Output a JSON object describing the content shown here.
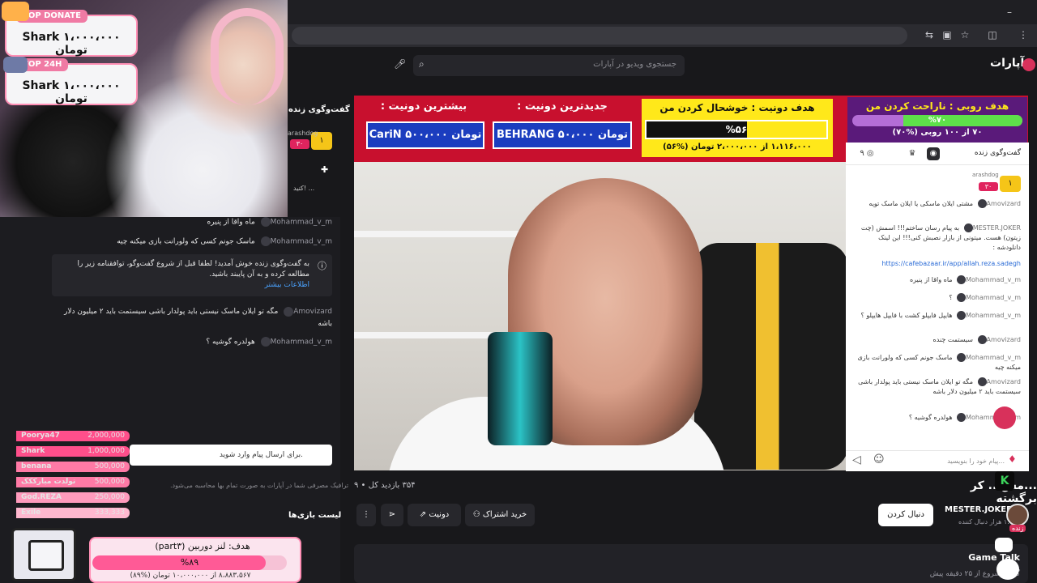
{
  "site": {
    "logo": "آپارات",
    "search_placeholder": "جستجوی ویدیو در آپارات"
  },
  "overlay": {
    "top_donate": {
      "tag": "TOP DONATE",
      "amount": "Shark ۱،۰۰۰،۰۰۰ تومان"
    },
    "top_24h": {
      "tag": "TOP 24H",
      "amount": "Shark ۱،۰۰۰،۰۰۰ تومان"
    }
  },
  "left_chat": {
    "title": "گفت‌وگوی زنده",
    "badge_user": "arashdog",
    "badge_level": "۳۰",
    "badge_num": "۱",
    "pinned": "کنید! ...",
    "messages": [
      {
        "user": "Mohammad_v_m",
        "text": "ماه واقا از پنیره"
      },
      {
        "user": "Mohammad_v_m",
        "text": "ماسک جونم کسی که ولورانت بازی میکنه چیه"
      },
      {
        "user": "Amovizard",
        "text": "مگه تو ایلان ماسک نیستی باید پولدار باشی سیستمت باید ۲ میلیون دلار باشه"
      },
      {
        "user": "Mohammad_v_m",
        "text": "هولدره گوشیه ؟"
      }
    ],
    "welcome": "به گفت‌وگوی زنده خوش آمدید! لطفا قبل از شروع گفت‌وگو، توافقنامه زیر را مطالعه کرده و به آن پایبند باشید.",
    "welcome_link": "اطلاعات بیشتر",
    "input_placeholder": "برای ارسال پیام وارد شوید.",
    "traffic_note": "ترافیک مصرفی شما در آپارات به صورت تمام بها محاسبه می‌شود.",
    "games_title": "لیست بازی‌ها"
  },
  "leaderboard": [
    {
      "name": "Poorya47",
      "value": "2,000,000",
      "color": "#ff4f8b"
    },
    {
      "name": "Shark",
      "value": "1,000,000",
      "color": "#ff4f8b"
    },
    {
      "name": "benana",
      "value": "500,000",
      "color": "#ff7aa6"
    },
    {
      "name": "تولدت مبارککک",
      "value": "500,000",
      "color": "#ff7aa6"
    },
    {
      "name": "God.REZA",
      "value": "250,000",
      "color": "#ff9bbd"
    },
    {
      "name": "Exile",
      "value": "333,333",
      "color": "#ffb8cf"
    }
  ],
  "bottom_goal": {
    "title": "هدف: لنز دوربین (part۳)",
    "percent": "%۸۹",
    "progress": 0.89,
    "sub": "۸،۸۸۳،۵۶۷ از ۱۰،۰۰۰،۰۰۰ تومان (%۸۹)"
  },
  "banner": {
    "top_title": "بیشترین دونیت :",
    "top_value": "CariN ۵۰۰،۰۰۰ تومان",
    "latest_title": "جدیدترین دونیت :",
    "latest_value": "BEHRANG ۵۰،۰۰۰ تومان",
    "goal_title": "هدف دونیت : خوشحال کردن من",
    "goal_pct": "%۵۶",
    "goal_progress": 0.56,
    "goal_sub": "۱،۱۱۶،۰۰۰ از ۲،۰۰۰،۰۰۰ تومان (%۵۶)",
    "ruby_title": "هدف روبی : ناراحت کردن من",
    "ruby_pct": "%۷۰",
    "ruby_progress": 0.7,
    "ruby_sub": "۷۰ از ۱۰۰ روبی (%۷۰)"
  },
  "right_chat": {
    "title": "گفت‌وگوی زنده",
    "viewers": "۹",
    "badge_user": "arashdog",
    "badge_level": "۳۰",
    "badge_num": "۱",
    "messages": [
      {
        "user": "Amovizard",
        "text": "مشتی ایلان ماسکی یا ایلان ماسک تویه"
      },
      {
        "user": "MESTER.JOKER",
        "text": "به پیام رسان ساختم!!! اسمش (چت زیتون) هست. میتونی از بازار نصبش کنی!!! این لینک دانلودشه :"
      },
      {
        "link": "https://cafebazaar.ir/app/allah.reza.sadegh"
      },
      {
        "user": "Mohammad_v_m",
        "text": "ماه واقا از پنیره"
      },
      {
        "user": "Mohammad_v_m",
        "text": "؟"
      },
      {
        "user": "Mohammad_v_m",
        "text": "هایپل فایپلو کشت با فایپل هایپلو ؟"
      },
      {
        "user": "Amovizard",
        "text": "سیستمت چنده"
      },
      {
        "user": "Mohammad_v_m",
        "text": "ماسک جونم کسی که ولورانت بازی میکنه چیه"
      },
      {
        "user": "Amovizard",
        "text": "مگه تو ایلان ماسک نیستی باید پولدار باشی سیستمت باید ۲ میلیون دلار باشه"
      },
      {
        "user": "Mohammad_v_m",
        "text": "هولدره گوشیه ؟"
      }
    ],
    "input_placeholder": "پیام خود را بنویسید..."
  },
  "video": {
    "title": "...مس... کر برگشته",
    "stats": "۳۵۴ بازدید کل • ۹",
    "channel": "MESTER.JOKER",
    "followers": "۱.۱ هزار دنبال کننده",
    "follow_label": "دنبال کردن",
    "subscribe_label": "خرید اشتراک",
    "donate_label": "دونیت",
    "live_label": "زنده"
  },
  "game_talk": {
    "title": "Game Talk",
    "sub": "گیم • شروع از ۲۵ دقیقه پیش"
  }
}
